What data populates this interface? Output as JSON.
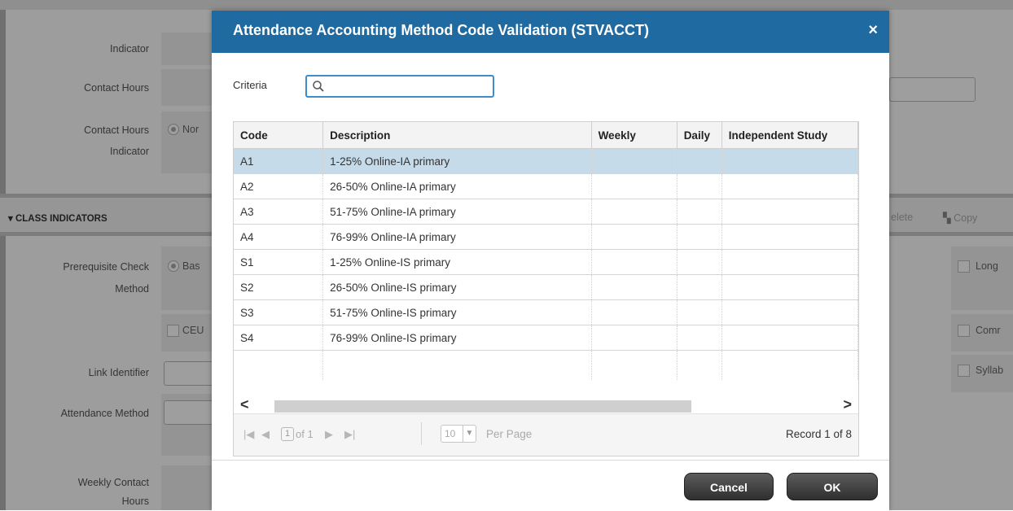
{
  "background": {
    "fields": [
      {
        "label_line1": "Indicator",
        "label_line2": ""
      },
      {
        "label_line1": "Contact Hours",
        "label_line2": ""
      },
      {
        "label_line1": "Contact Hours",
        "label_line2": "Indicator"
      }
    ],
    "contact_hours_indicator_option": "Nor",
    "section_title": "CLASS INDICATORS",
    "toolbar_delete": "elete",
    "toolbar_copy": "Copy",
    "prereq_label_line1": "Prerequisite Check",
    "prereq_label_line2": "Method",
    "prereq_option": "Bas",
    "ceu_checkbox": "CEU",
    "link_identifier_label": "Link Identifier",
    "attendance_method_label": "Attendance Method",
    "weekly_label_line1": "Weekly Contact",
    "weekly_label_line2": "Hours",
    "right_checks": [
      "Long",
      "Comr",
      "Syllab"
    ]
  },
  "modal": {
    "title": "Attendance Accounting Method Code Validation (STVACCT)",
    "close_glyph": "×",
    "criteria_label": "Criteria",
    "criteria_value": "",
    "columns": [
      "Code",
      "Description",
      "Weekly",
      "Daily",
      "Independent Study"
    ],
    "rows": [
      {
        "code": "A1",
        "description": "1-25% Online-IA primary",
        "weekly": "",
        "daily": "",
        "independent": ""
      },
      {
        "code": "A2",
        "description": "26-50% Online-IA primary",
        "weekly": "",
        "daily": "",
        "independent": ""
      },
      {
        "code": "A3",
        "description": "51-75% Online-IA primary",
        "weekly": "",
        "daily": "",
        "independent": ""
      },
      {
        "code": "A4",
        "description": "76-99% Online-IA primary",
        "weekly": "",
        "daily": "",
        "independent": ""
      },
      {
        "code": "S1",
        "description": "1-25% Online-IS primary",
        "weekly": "",
        "daily": "",
        "independent": ""
      },
      {
        "code": "S2",
        "description": "26-50% Online-IS primary",
        "weekly": "",
        "daily": "",
        "independent": ""
      },
      {
        "code": "S3",
        "description": "51-75% Online-IS primary",
        "weekly": "",
        "daily": "",
        "independent": ""
      },
      {
        "code": "S4",
        "description": "76-99% Online-IS primary",
        "weekly": "",
        "daily": "",
        "independent": ""
      }
    ],
    "selected_row": 0,
    "pager": {
      "current_page": "1",
      "of_text": "of 1",
      "page_size": "10",
      "per_page_label": "Per Page",
      "record_text": "Record 1 of 8"
    },
    "cancel_label": "Cancel",
    "ok_label": "OK"
  },
  "colors": {
    "header_blue": "#1f6aa0",
    "selected_row": "#c6dbe9",
    "focus_border": "#3f8ccc"
  }
}
